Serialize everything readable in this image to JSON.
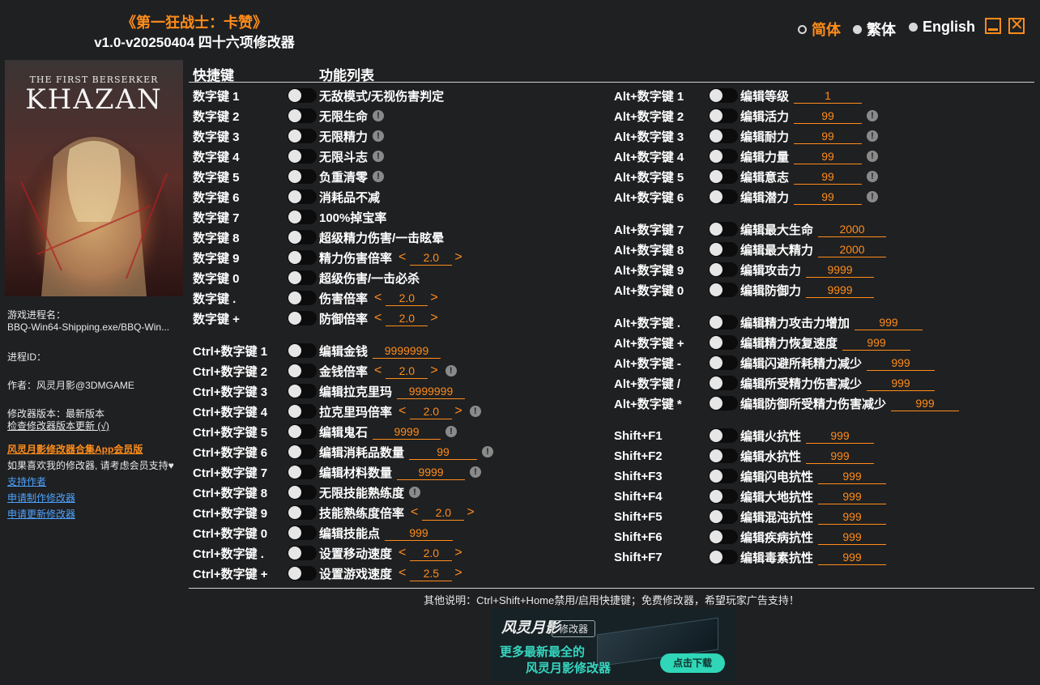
{
  "header": {
    "title": "《第一狂战士：卡赞》",
    "subtitle": "v1.0-v20250404 四十六项修改器"
  },
  "languages": [
    {
      "label": "简体",
      "selected": true
    },
    {
      "label": "繁体",
      "selected": false
    },
    {
      "label": "English",
      "selected": false
    }
  ],
  "window": {
    "minimize_icon": "minimize-icon",
    "close_icon": "close-icon"
  },
  "cover": {
    "line1": "THE FIRST BERSERKER",
    "line2": "KHAZAN"
  },
  "sidebar": {
    "process_label": "游戏进程名：",
    "process_value": "BBQ-Win64-Shipping.exe/BBQ-Win...",
    "pid_label": "进程ID：",
    "author": "作者：风灵月影@3DMGAME",
    "version": "修改器版本：最新版本",
    "check_update": "检查修改器版本更新 (√)",
    "vip": "风灵月影修改器合集App会员版",
    "support_text": "如果喜欢我的修改器, 请考虑会员支持♥",
    "links": [
      "支持作者",
      "申请制作修改器",
      "申请更新修改器"
    ]
  },
  "columns": {
    "hotkey": "快捷键",
    "features": "功能列表"
  },
  "left_rows": [
    {
      "key": "数字键 1",
      "label": "无敌模式/无视伤害判定"
    },
    {
      "key": "数字键 2",
      "label": "无限生命",
      "info": true
    },
    {
      "key": "数字键 3",
      "label": "无限精力",
      "info": true
    },
    {
      "key": "数字键 4",
      "label": "无限斗志",
      "info": true
    },
    {
      "key": "数字键 5",
      "label": "负重清零",
      "info": true
    },
    {
      "key": "数字键 6",
      "label": "消耗品不减"
    },
    {
      "key": "数字键 7",
      "label": "100%掉宝率"
    },
    {
      "key": "数字键 8",
      "label": "超级精力伤害/一击眩晕"
    },
    {
      "key": "数字键 9",
      "label": "精力伤害倍率",
      "value": "2.0",
      "arrows": true
    },
    {
      "key": "数字键 0",
      "label": "超级伤害/一击必杀"
    },
    {
      "key": "数字键 .",
      "label": "伤害倍率",
      "value": "2.0",
      "arrows": true
    },
    {
      "key": "数字键 +",
      "label": "防御倍率",
      "value": "2.0",
      "arrows": true
    },
    {
      "key": "Ctrl+数字键 1",
      "label": "编辑金钱",
      "value": "9999999"
    },
    {
      "key": "Ctrl+数字键 2",
      "label": "金钱倍率",
      "value": "2.0",
      "arrows": true,
      "info": true
    },
    {
      "key": "Ctrl+数字键 3",
      "label": "编辑拉克里玛",
      "value": "9999999"
    },
    {
      "key": "Ctrl+数字键 4",
      "label": "拉克里玛倍率",
      "value": "2.0",
      "arrows": true,
      "info": true
    },
    {
      "key": "Ctrl+数字键 5",
      "label": "编辑鬼石",
      "value": "9999",
      "info": true
    },
    {
      "key": "Ctrl+数字键 6",
      "label": "编辑消耗品数量",
      "value": "99",
      "info": true
    },
    {
      "key": "Ctrl+数字键 7",
      "label": "编辑材料数量",
      "value": "9999",
      "info": true
    },
    {
      "key": "Ctrl+数字键 8",
      "label": "无限技能熟练度",
      "info": true
    },
    {
      "key": "Ctrl+数字键 9",
      "label": "技能熟练度倍率",
      "value": "2.0",
      "arrows": true
    },
    {
      "key": "Ctrl+数字键 0",
      "label": "编辑技能点",
      "value": "999"
    },
    {
      "key": "Ctrl+数字键 .",
      "label": "设置移动速度",
      "value": "2.0",
      "arrows": true
    },
    {
      "key": "Ctrl+数字键 +",
      "label": "设置游戏速度",
      "value": "2.5",
      "arrows": true
    }
  ],
  "right_rows": [
    {
      "key": "Alt+数字键 1",
      "label": "编辑等级",
      "value": "1"
    },
    {
      "key": "Alt+数字键 2",
      "label": "编辑活力",
      "value": "99",
      "info": true
    },
    {
      "key": "Alt+数字键 3",
      "label": "编辑耐力",
      "value": "99",
      "info": true
    },
    {
      "key": "Alt+数字键 4",
      "label": "编辑力量",
      "value": "99",
      "info": true
    },
    {
      "key": "Alt+数字键 5",
      "label": "编辑意志",
      "value": "99",
      "info": true
    },
    {
      "key": "Alt+数字键 6",
      "label": "编辑潜力",
      "value": "99",
      "info": true
    },
    {
      "key": "Alt+数字键 7",
      "label": "编辑最大生命",
      "value": "2000"
    },
    {
      "key": "Alt+数字键 8",
      "label": "编辑最大精力",
      "value": "2000"
    },
    {
      "key": "Alt+数字键 9",
      "label": "编辑攻击力",
      "value": "9999"
    },
    {
      "key": "Alt+数字键 0",
      "label": "编辑防御力",
      "value": "9999"
    },
    {
      "key": "Alt+数字键 .",
      "label": "编辑精力攻击力增加",
      "value": "999"
    },
    {
      "key": "Alt+数字键 +",
      "label": "编辑精力恢复速度",
      "value": "999"
    },
    {
      "key": "Alt+数字键 -",
      "label": "编辑闪避所耗精力减少",
      "value": "999"
    },
    {
      "key": "Alt+数字键 /",
      "label": "编辑所受精力伤害减少",
      "value": "999"
    },
    {
      "key": "Alt+数字键 *",
      "label": "编辑防御所受精力伤害减少",
      "value": "999"
    },
    {
      "key": "Shift+F1",
      "label": "编辑火抗性",
      "value": "999"
    },
    {
      "key": "Shift+F2",
      "label": "编辑水抗性",
      "value": "999"
    },
    {
      "key": "Shift+F3",
      "label": "编辑闪电抗性",
      "value": "999"
    },
    {
      "key": "Shift+F4",
      "label": "编辑大地抗性",
      "value": "999"
    },
    {
      "key": "Shift+F5",
      "label": "编辑混沌抗性",
      "value": "999"
    },
    {
      "key": "Shift+F6",
      "label": "编辑疾病抗性",
      "value": "999"
    },
    {
      "key": "Shift+F7",
      "label": "编辑毒素抗性",
      "value": "999"
    }
  ],
  "footer": {
    "note": "其他说明：Ctrl+Shift+Home禁用/启用快捷键；免费修改器，希望玩家广告支持！"
  },
  "banner": {
    "logo": "风灵月影",
    "tag": "修改器",
    "line1": "更多最新最全的",
    "line2": "风灵月影修改器",
    "download": "点击下载"
  },
  "colors": {
    "accent": "#ff8c1a",
    "background": "#1f2022",
    "link": "#4da3ff"
  }
}
